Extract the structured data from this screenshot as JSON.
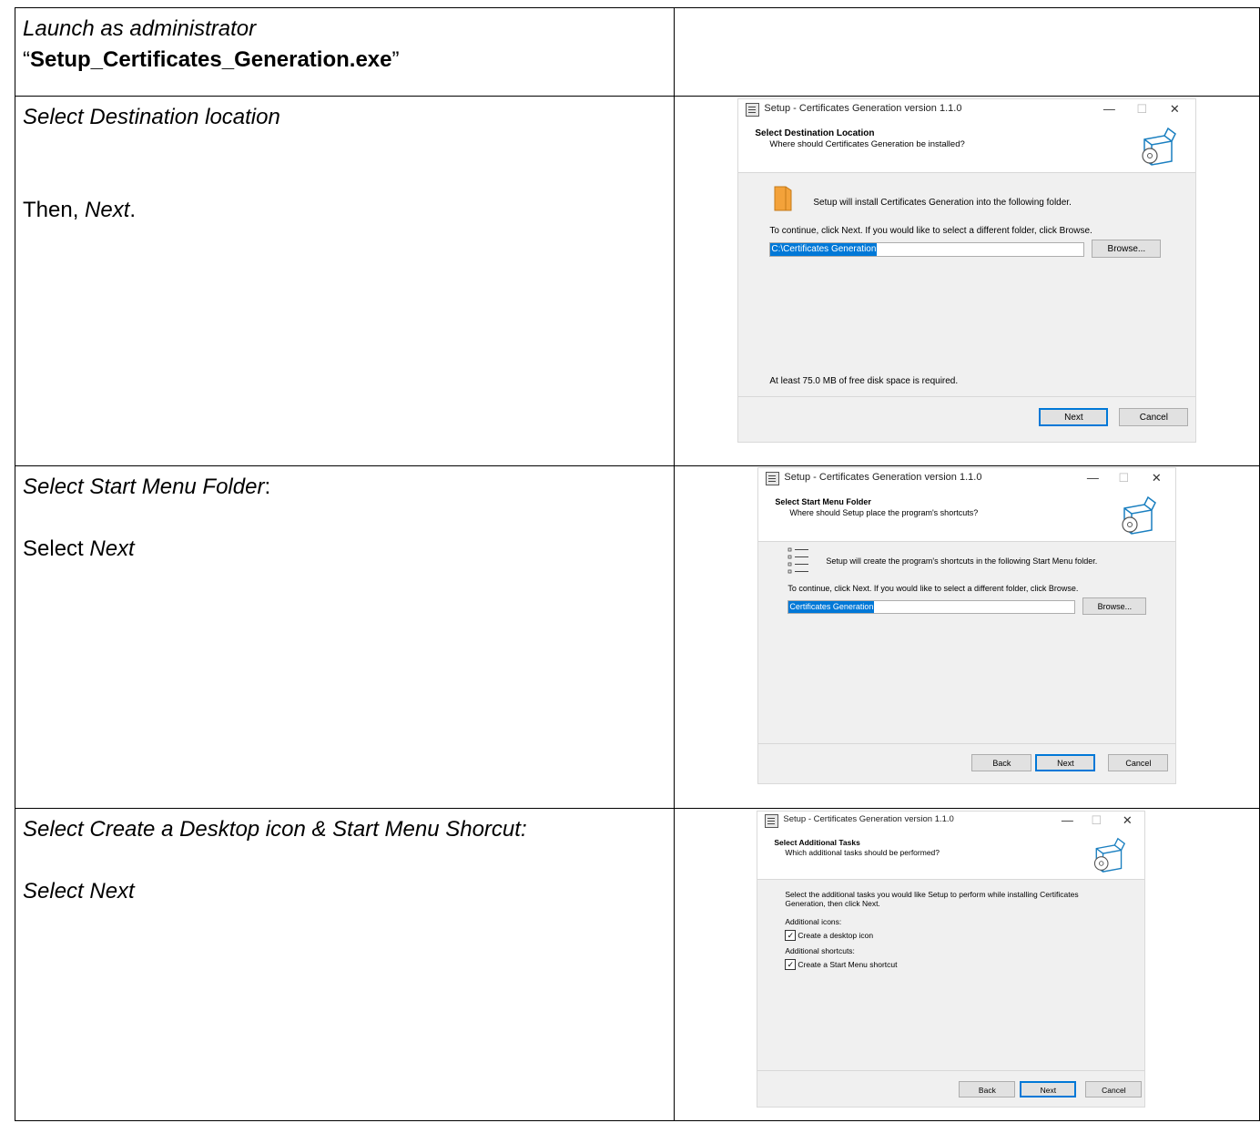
{
  "rows": [
    {
      "instructions": [
        {
          "segments": [
            {
              "text": "Launch as administrator",
              "style": "it"
            }
          ]
        },
        {
          "segments": [
            {
              "text": "“",
              "style": ""
            },
            {
              "text": "Setup_Certificates_Generation.exe",
              "style": "bd"
            },
            {
              "text": "”",
              "style": ""
            }
          ]
        }
      ]
    },
    {
      "instructions": [
        {
          "segments": [
            {
              "text": "Select Destination location",
              "style": "it"
            }
          ]
        },
        {
          "segments": []
        },
        {
          "segments": []
        },
        {
          "segments": [
            {
              "text": "Then, ",
              "style": ""
            },
            {
              "text": "Next",
              "style": "it"
            },
            {
              "text": ".",
              "style": ""
            }
          ]
        }
      ]
    },
    {
      "instructions": [
        {
          "segments": [
            {
              "text": "Select Start Menu Folder",
              "style": "it"
            },
            {
              "text": ":",
              "style": ""
            }
          ]
        },
        {
          "segments": []
        },
        {
          "segments": [
            {
              "text": "Select ",
              "style": ""
            },
            {
              "text": "Next",
              "style": "it"
            }
          ]
        }
      ]
    },
    {
      "instructions": [
        {
          "segments": [
            {
              "text": "Select Create a Desktop icon & Start Menu Shorcut:",
              "style": "it"
            }
          ]
        },
        {
          "segments": []
        },
        {
          "segments": [
            {
              "text": "Select Next",
              "style": "it"
            }
          ]
        }
      ]
    }
  ],
  "dialogs": {
    "window_title": "Setup - Certificates Generation version 1.1.0",
    "window_controls": {
      "minimize": "—",
      "maximize": "☐",
      "close": "✕"
    },
    "destination": {
      "header_title": "Select Destination Location",
      "header_subtitle": "Where should Certificates Generation be installed?",
      "info": "Setup will install Certificates Generation into the following folder.",
      "continue_text": "To continue, click Next. If you would like to select a different folder, click Browse.",
      "path_value": "C:\\Certificates Generation",
      "browse_label": "Browse...",
      "disk_space": "At least 75.0 MB of free disk space is required.",
      "next_label": "Next",
      "cancel_label": "Cancel"
    },
    "start_menu": {
      "header_title": "Select Start Menu Folder",
      "header_subtitle": "Where should Setup place the program's shortcuts?",
      "info": "Setup will create the program's shortcuts in the following Start Menu folder.",
      "continue_text": "To continue, click Next. If you would like to select a different folder, click Browse.",
      "folder_value": "Certificates Generation",
      "browse_label": "Browse...",
      "back_label": "Back",
      "next_label": "Next",
      "cancel_label": "Cancel"
    },
    "tasks": {
      "header_title": "Select Additional Tasks",
      "header_subtitle": "Which additional tasks should be performed?",
      "intro_line1": "Select the additional tasks you would like Setup to perform while installing Certificates",
      "intro_line2": "Generation, then click Next.",
      "icons_group": "Additional icons:",
      "desktop_icon_label": "Create a desktop icon",
      "shortcuts_group": "Additional shortcuts:",
      "start_menu_label": "Create a Start Menu shortcut",
      "check_mark": "✓",
      "back_label": "Back",
      "next_label": "Next",
      "cancel_label": "Cancel"
    }
  }
}
